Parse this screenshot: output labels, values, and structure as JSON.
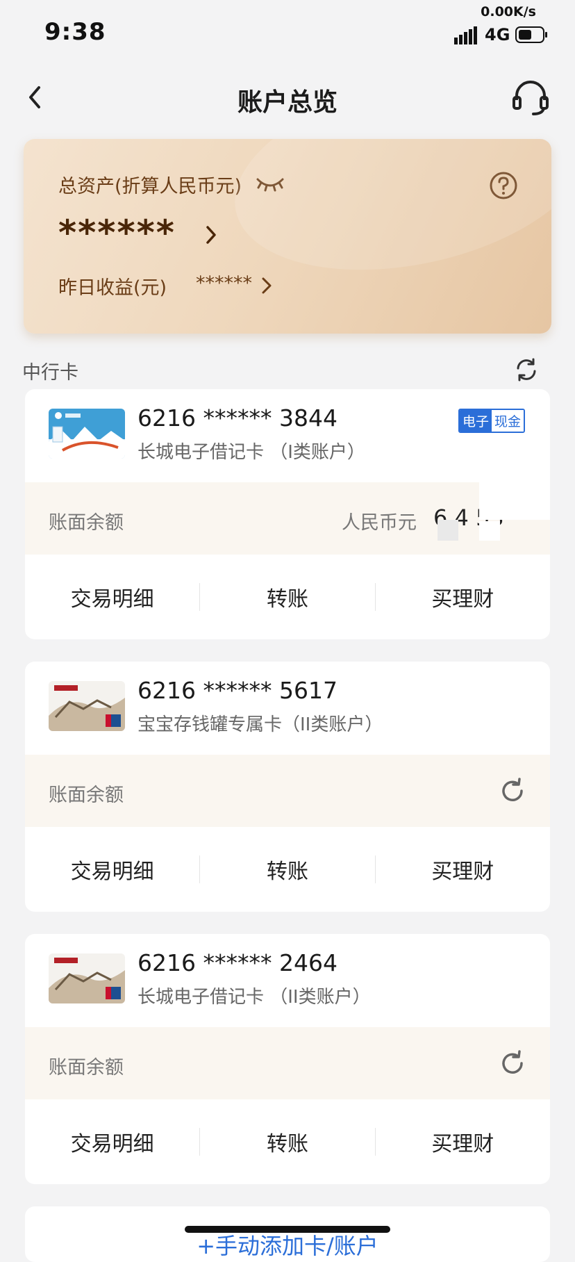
{
  "status_bar": {
    "time": "9:38",
    "net_speed": "0.00K/s",
    "network": "4G"
  },
  "nav": {
    "title": "账户总览",
    "back_icon": "chevron-left-icon",
    "service_icon": "headset-icon"
  },
  "asset_summary": {
    "label": "总资产(折算人民币元)",
    "value": "******",
    "yesterday_label": "昨日收益(元)",
    "yesterday_value": "******",
    "colors": {
      "card_bg": "#efd8bd",
      "text": "#6a3d17"
    }
  },
  "section": {
    "label": "中行卡"
  },
  "accounts": [
    {
      "number": "6216 ****** 3844",
      "type": "长城电子借记卡 （I类账户）",
      "badge_left": "电子",
      "badge_right": "现金",
      "balance_label": "账面余额",
      "currency": "人民币元",
      "amount": "6 4  53",
      "actions": [
        "交易明细",
        "转账",
        "买理财"
      ]
    },
    {
      "number": "6216 ****** 5617",
      "type": "宝宝存钱罐专属卡（II类账户）",
      "balance_label": "账面余额",
      "actions": [
        "交易明细",
        "转账",
        "买理财"
      ]
    },
    {
      "number": "6216 ****** 2464",
      "type": "长城电子借记卡 （II类账户）",
      "balance_label": "账面余额",
      "actions": [
        "交易明细",
        "转账",
        "买理财"
      ]
    }
  ],
  "add_account": {
    "label": "+手动添加卡/账户"
  },
  "colors": {
    "accent_blue": "#2b6ed8",
    "page_bg": "#f3f3f4"
  }
}
